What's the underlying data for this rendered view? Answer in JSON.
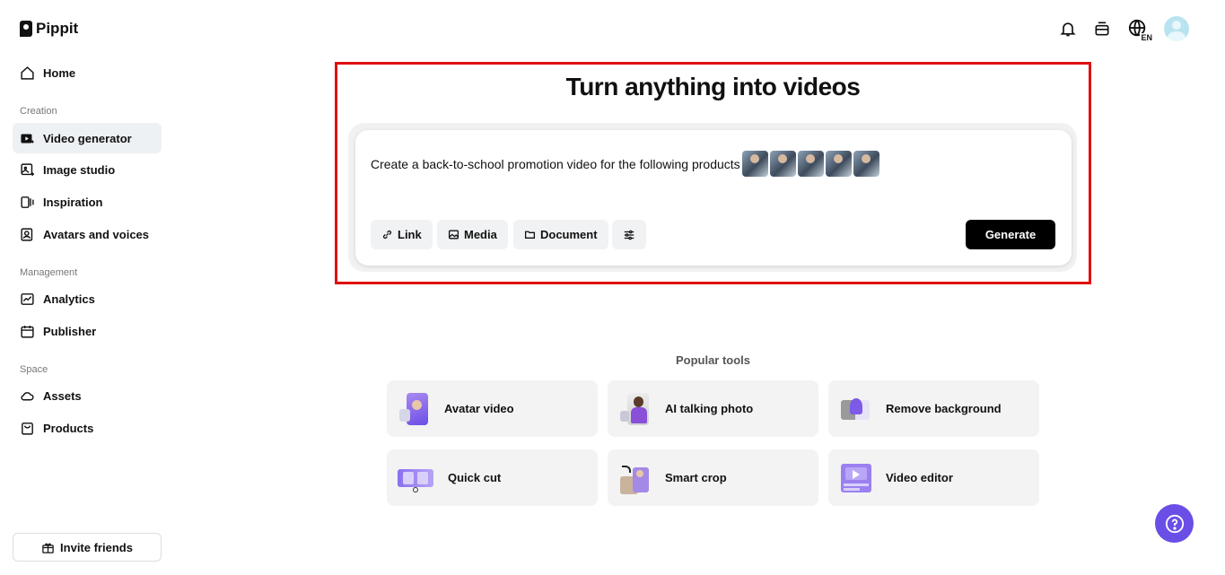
{
  "app": {
    "name": "Pippit"
  },
  "sidebar": {
    "home": "Home",
    "sections": [
      {
        "label": "Creation",
        "items": [
          "Video generator",
          "Image studio",
          "Inspiration",
          "Avatars and voices"
        ]
      },
      {
        "label": "Management",
        "items": [
          "Analytics",
          "Publisher"
        ]
      },
      {
        "label": "Space",
        "items": [
          "Assets",
          "Products"
        ]
      }
    ],
    "invite_label": "Invite friends"
  },
  "topbar": {
    "language": "EN"
  },
  "main": {
    "headline": "Turn anything into videos",
    "prompt_text": "Create a back-to-school promotion video for the following products",
    "buttons": {
      "link": "Link",
      "media": "Media",
      "document": "Document",
      "generate": "Generate"
    },
    "popular_label": "Popular tools",
    "tools": [
      "Avatar video",
      "AI talking photo",
      "Remove background",
      "Quick cut",
      "Smart crop",
      "Video editor"
    ]
  },
  "colors": {
    "accent": "#6b4ee6",
    "highlight": "#e01010",
    "active_nav": "#eef1f4"
  }
}
